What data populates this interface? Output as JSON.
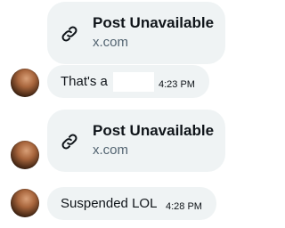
{
  "messages": [
    {
      "kind": "link-card",
      "icon": "link-icon",
      "title": "Post Unavailable",
      "domain": "x.com"
    },
    {
      "kind": "text",
      "avatar": "avatar",
      "text": "That's a",
      "time": "4:23 PM"
    },
    {
      "kind": "link-card",
      "icon": "link-icon",
      "title": "Post Unavailable",
      "domain": "x.com"
    },
    {
      "kind": "text",
      "avatar": "avatar",
      "text": "Suspended LOL",
      "time": "4:28 PM"
    }
  ],
  "colors": {
    "bubble": "#eff3f4",
    "text": "#0f1419",
    "secondary": "#536471"
  }
}
